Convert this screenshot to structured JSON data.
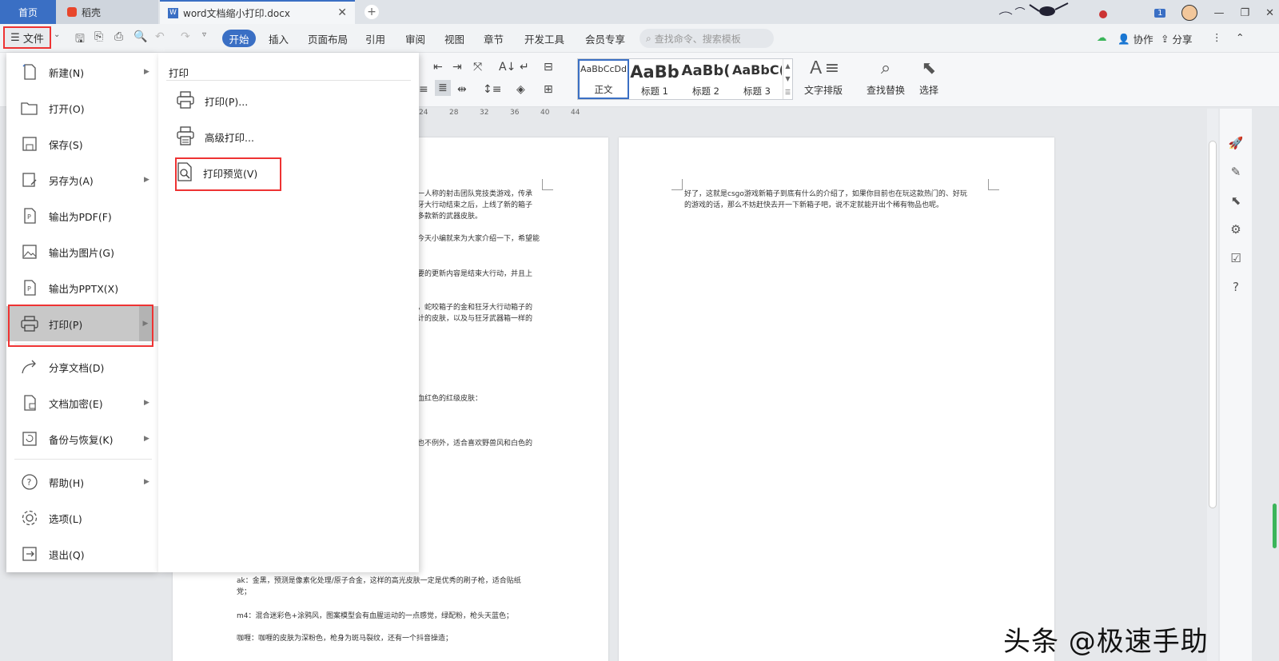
{
  "tabs": {
    "home": "首页",
    "daoke": "稻壳",
    "document": "word文档缩小打印.docx",
    "notification_count": "1"
  },
  "menubar": {
    "file_label": "文件",
    "items": [
      "开始",
      "插入",
      "页面布局",
      "引用",
      "审阅",
      "视图",
      "章节",
      "开发工具",
      "会员专享"
    ],
    "search_placeholder": "查找命令、搜索模板",
    "collaborate": "协作",
    "share": "分享"
  },
  "ribbon": {
    "styles": [
      {
        "preview": "AaBbCcDd",
        "name": "正文"
      },
      {
        "preview": "AaBb",
        "name": "标题 1"
      },
      {
        "preview": "AaBb(",
        "name": "标题 2"
      },
      {
        "preview": "AaBbC(",
        "name": "标题 3"
      }
    ],
    "text_layout": "文字排版",
    "find_replace": "查找替换",
    "select": "选择",
    "ruler_ticks": [
      "24",
      "28",
      "32",
      "36",
      "40",
      "44"
    ]
  },
  "file_menu": {
    "items": [
      {
        "label": "新建(N)",
        "icon": "new-doc-icon",
        "arrow": true
      },
      {
        "label": "打开(O)",
        "icon": "folder-open-icon",
        "arrow": false
      },
      {
        "label": "保存(S)",
        "icon": "save-icon",
        "arrow": false
      },
      {
        "label": "另存为(A)",
        "icon": "save-as-icon",
        "arrow": true
      },
      {
        "label": "输出为PDF(F)",
        "icon": "pdf-icon",
        "arrow": false
      },
      {
        "label": "输出为图片(G)",
        "icon": "image-icon",
        "arrow": false
      },
      {
        "label": "输出为PPTX(X)",
        "icon": "pptx-icon",
        "arrow": false
      },
      {
        "label": "打印(P)",
        "icon": "printer-icon",
        "arrow": true,
        "active": true
      },
      {
        "label": "分享文档(D)",
        "icon": "share-icon",
        "arrow": false
      },
      {
        "label": "文档加密(E)",
        "icon": "encrypt-icon",
        "arrow": true
      },
      {
        "label": "备份与恢复(K)",
        "icon": "backup-icon",
        "arrow": true
      },
      {
        "label": "帮助(H)",
        "icon": "help-icon",
        "arrow": true
      },
      {
        "label": "选项(L)",
        "icon": "gear-icon",
        "arrow": false
      },
      {
        "label": "退出(Q)",
        "icon": "exit-icon",
        "arrow": false
      }
    ]
  },
  "print_submenu": {
    "title": "打印",
    "items": [
      {
        "label": "打印(P)...",
        "icon": "printer-icon"
      },
      {
        "label": "高级打印...",
        "icon": "advanced-print-icon"
      },
      {
        "label": "打印预览(V)",
        "icon": "print-preview-icon"
      }
    ]
  },
  "document": {
    "page1_fragments": [
      "一人称的射击团队竞技类游戏，传承",
      "牙大行动结束之后，上线了新的箱子",
      "多款新的武器皮肤。",
      "今天小编就来为大家介绍一下，希望能",
      "要的更新内容是结束大行动，并且上",
      "，蛇咬箱子的金和狂牙大行动箱子的",
      "计的皮肤，以及与狂牙武器箱一样的",
      "血红色的红级皮肤：",
      "也不例外，适合喜欢野兽风和白色的",
      "ak：金黑，预测是像素化处理/原子合金，这样的高光皮肤一定是优秀的刷子枪，适合贴纸",
      "党；",
      "m4：混合迷彩色+涂鸦风，图案模型会有血腥运动的一点感觉，绿配粉，枪头天蓝色；",
      "咖喱：咖喱的皮肤为深粉色，枪身为斑马裂纹，还有一个抖音操造；"
    ],
    "page2_text": [
      "好了，这就是csgo游戏新箱子到底有什么的介绍了，如果你目前也在玩这款热门的、好玩",
      "的游戏的话，那么不妨赶快去开一下新箱子吧，说不定就能开出个稀有物品也呢。"
    ]
  },
  "watermark": "头条 @极速手助"
}
